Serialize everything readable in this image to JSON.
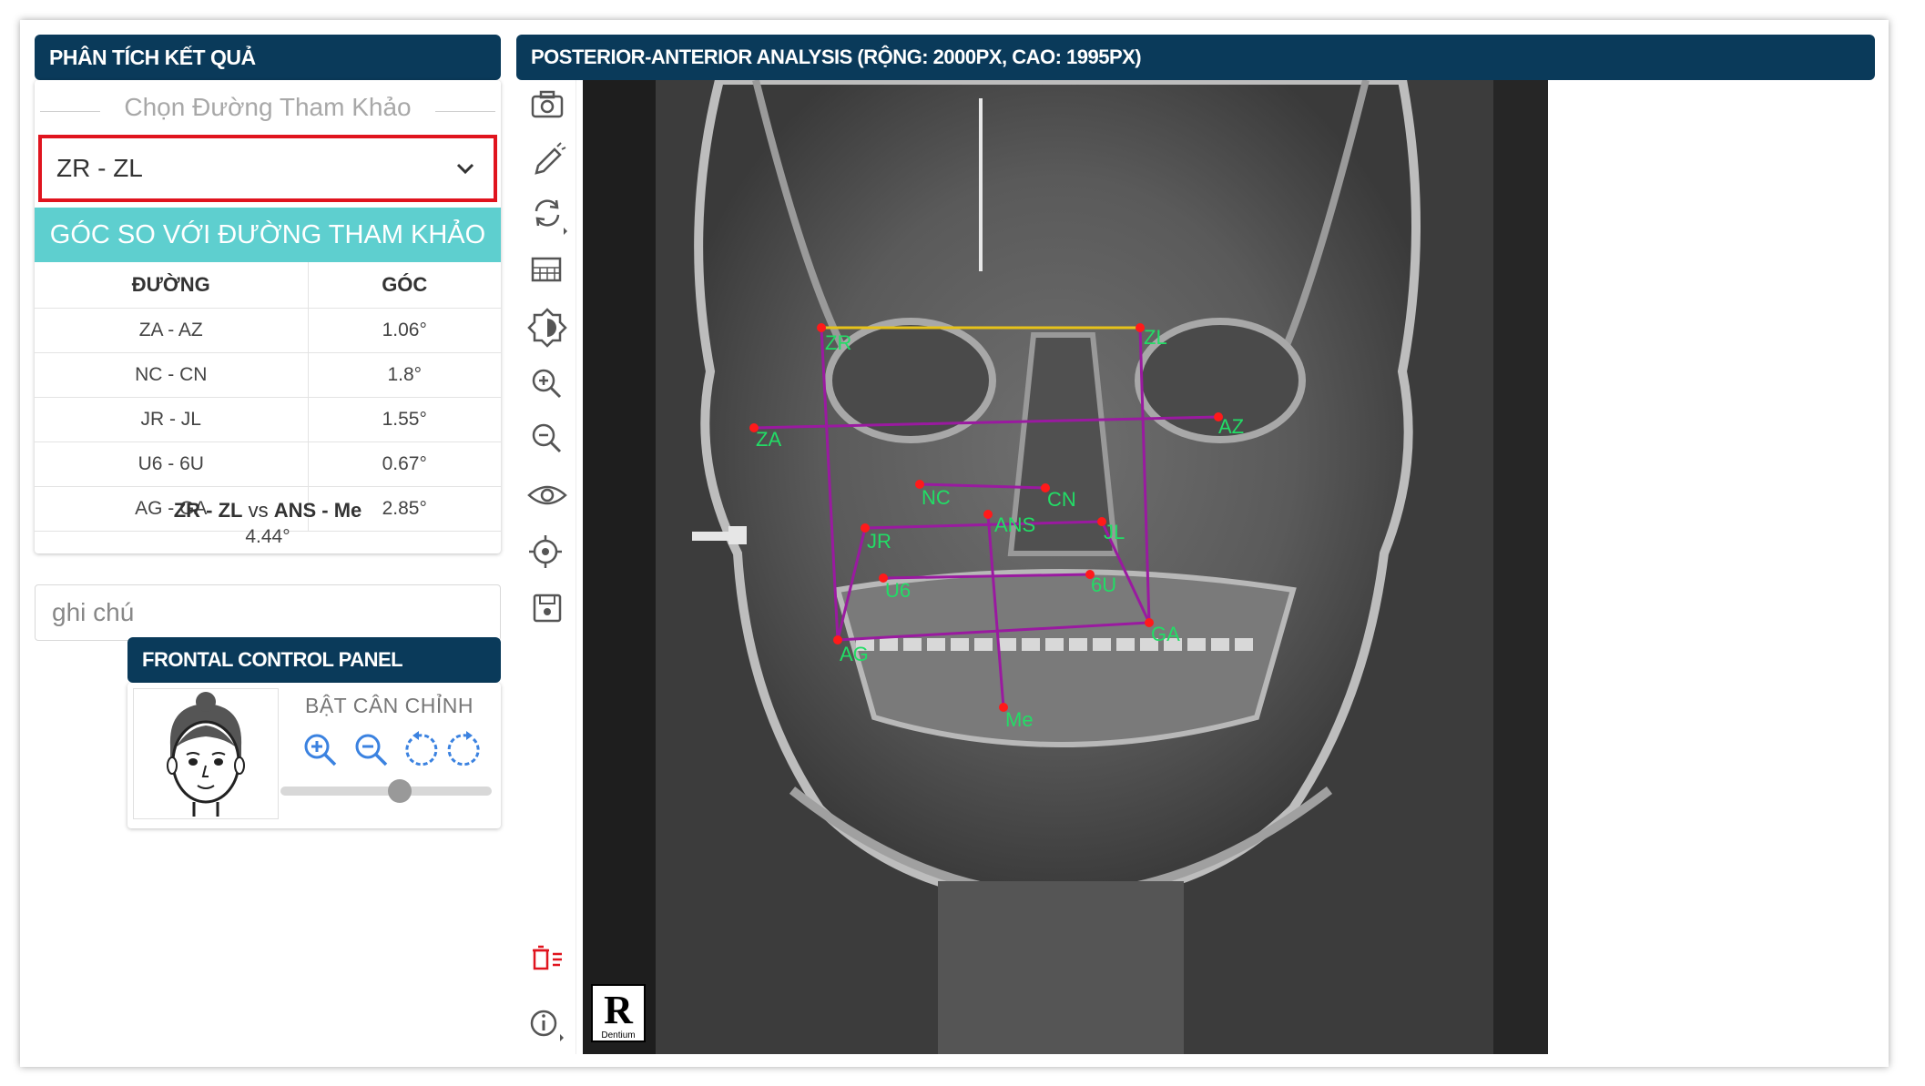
{
  "left_panel": {
    "title": "PHÂN TÍCH KẾT QUẢ",
    "reference_label": "Chọn Đường Tham Khảo",
    "selected_reference": "ZR - ZL",
    "angle_title": "GÓC SO VỚI ĐƯỜNG THAM KHẢO",
    "table": {
      "headers": [
        "ĐƯỜNG",
        "GÓC"
      ],
      "rows": [
        {
          "line": "ZA - AZ",
          "angle": "1.06°"
        },
        {
          "line": "NC - CN",
          "angle": "1.8°"
        },
        {
          "line": "JR - JL",
          "angle": "1.55°"
        },
        {
          "line": "U6 - 6U",
          "angle": "0.67°"
        },
        {
          "line": "AG - GA",
          "angle": "2.85°"
        }
      ]
    },
    "comparison": {
      "ref": "ZR - ZL",
      "vs_word": "vs",
      "other": "ANS - Me",
      "value": "4.44°"
    },
    "note_placeholder": "ghi chú"
  },
  "frontal_panel": {
    "title": "FRONTAL CONTROL PANEL",
    "align_label": "BẬT CÂN CHỈNH",
    "icons": [
      "zoom-in-icon",
      "zoom-out-icon",
      "rotate-left-icon",
      "rotate-right-icon"
    ],
    "slider_level": 0.5
  },
  "viewer": {
    "title": "POSTERIOR-ANTERIOR ANALYSIS (RỘNG: 2000PX, CAO: 1995PX)",
    "toolbar_icons": [
      "camera-icon",
      "pen-icon",
      "rotate-icon",
      "grid-icon",
      "contrast-icon",
      "zoom-in-icon",
      "zoom-out-icon",
      "eye-icon",
      "target-icon",
      "save-icon",
      "delete-list-icon",
      "info-icon"
    ],
    "landmarks": [
      "ZR",
      "ZL",
      "ZA",
      "AZ",
      "NC",
      "CN",
      "ANS",
      "JR",
      "JL",
      "U6",
      "6U",
      "AG",
      "GA",
      "Me"
    ],
    "watermark": "R",
    "watermark_sub": "Dentium",
    "colors": {
      "header": "#0a3a5a",
      "accent": "#5ecfcf",
      "highlight": "#e0141e",
      "line": "#9a1aa0",
      "ref_line": "#e6c21a",
      "label": "#22dd66"
    }
  }
}
